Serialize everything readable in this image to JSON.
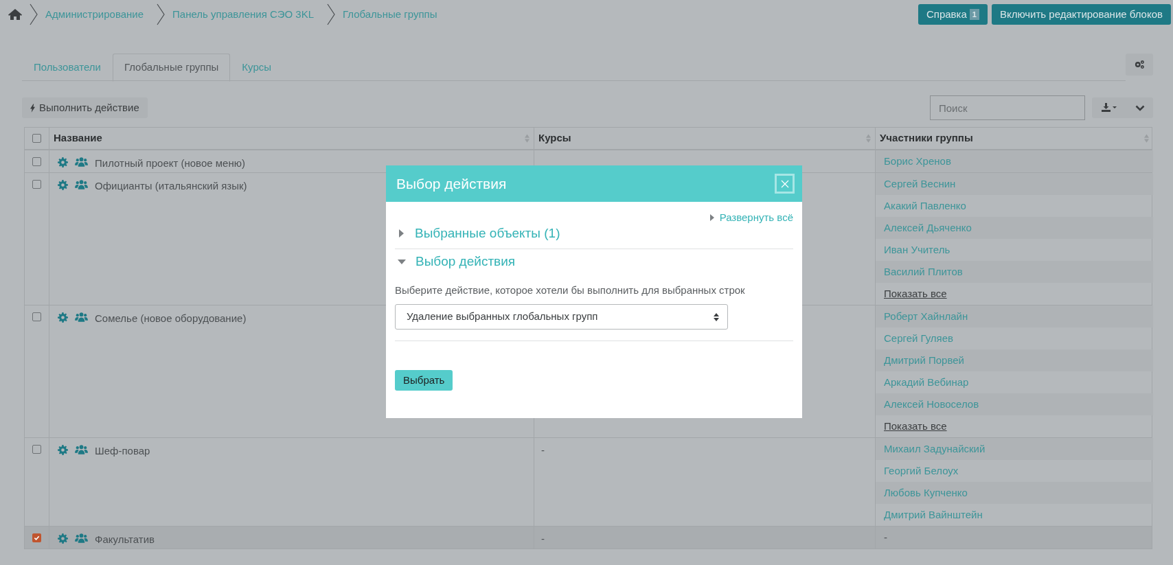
{
  "breadcrumb": [
    {
      "label": "Администрирование"
    },
    {
      "label": "Панель управления СЭО 3KL"
    },
    {
      "label": "Глобальные группы"
    }
  ],
  "header_buttons": [
    {
      "label": "Справка",
      "badge": "1"
    },
    {
      "label": "Включить редактирование блоков"
    }
  ],
  "tabs": [
    {
      "label": "Пользователи",
      "selected": false
    },
    {
      "label": "Глобальные группы",
      "selected": true
    },
    {
      "label": "Курсы",
      "selected": false
    }
  ],
  "action_button": "Выполнить действие",
  "search": {
    "placeholder": "Поиск"
  },
  "table": {
    "columns": [
      "Название",
      "Курсы",
      "Участники группы"
    ],
    "header_checked": false,
    "rows": [
      {
        "name": "Пилотный проект (новое меню)",
        "selected": false,
        "courses": [],
        "members": [
          {
            "kind": "person",
            "text": "Борис Хренов"
          }
        ]
      },
      {
        "name": "Официанты (итальянский язык)",
        "selected": false,
        "courses": [],
        "members": [
          {
            "kind": "person",
            "text": "Сергей Веснин"
          },
          {
            "kind": "person",
            "text": "Акакий Павленко"
          },
          {
            "kind": "person",
            "text": "Алексей Дьяченко"
          },
          {
            "kind": "person",
            "text": "Иван Учитель"
          },
          {
            "kind": "person",
            "text": "Василий Плитов"
          },
          {
            "kind": "show_all",
            "text": "Показать все"
          }
        ]
      },
      {
        "name": "Сомелье (новое оборудование)",
        "selected": false,
        "courses": [],
        "members": [
          {
            "kind": "person",
            "text": "Роберт Хайнлайн"
          },
          {
            "kind": "person",
            "text": "Сергей Гуляев"
          },
          {
            "kind": "person",
            "text": "Дмитрий Порвей"
          },
          {
            "kind": "person",
            "text": "Аркадий Вебинар"
          },
          {
            "kind": "person",
            "text": "Алексей Новоселов"
          },
          {
            "kind": "show_all",
            "text": "Показать все"
          }
        ]
      },
      {
        "name": "Шеф-повар",
        "selected": false,
        "courses": [
          "-"
        ],
        "members": [
          {
            "kind": "person",
            "text": "Михаил Задунайский"
          },
          {
            "kind": "person",
            "text": "Георгий Белоух"
          },
          {
            "kind": "person",
            "text": "Любовь Купченко"
          },
          {
            "kind": "person",
            "text": "Дмитрий Вайнштейн"
          }
        ]
      },
      {
        "name": "Факультатив",
        "selected": true,
        "courses": [
          "-"
        ],
        "members": [
          {
            "kind": "plain",
            "text": "-"
          }
        ]
      }
    ]
  },
  "modal": {
    "title": "Выбор действия",
    "expand_all": "Развернуть всё",
    "sections": [
      {
        "title": "Выбранные объекты (1)",
        "expanded": false
      },
      {
        "title": "Выбор действия",
        "expanded": true
      }
    ],
    "prompt": "Выберите действие, которое хотели бы выполнить для выбранных строк",
    "select_value": "Удаление выбранных глобальных групп",
    "submit": "Выбрать"
  }
}
